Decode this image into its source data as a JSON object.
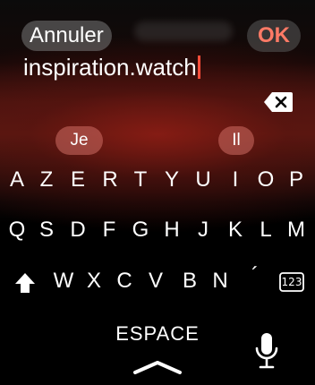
{
  "header": {
    "cancel_label": "Annuler",
    "ok_label": "OK",
    "ok_color": "#ff7a66"
  },
  "input": {
    "value": "inspiration.watch",
    "caret_color": "#ff4d3a",
    "delete_icon": "backspace-icon"
  },
  "suggestions": [
    "Je",
    "Il"
  ],
  "keyboard": {
    "row1": [
      "A",
      "Z",
      "E",
      "R",
      "T",
      "Y",
      "U",
      "I",
      "O",
      "P"
    ],
    "row2": [
      "Q",
      "S",
      "D",
      "F",
      "G",
      "H",
      "J",
      "K",
      "L",
      "M"
    ],
    "row3": [
      "W",
      "X",
      "C",
      "V",
      "B",
      "N",
      "´"
    ],
    "shift_icon": "shift-arrow-icon",
    "numbers_icon": "numbers-123-icon",
    "numbers_label": "123",
    "space_label": "ESPACE",
    "mic_icon": "microphone-icon",
    "dismiss_icon": "chevron-up-icon"
  }
}
